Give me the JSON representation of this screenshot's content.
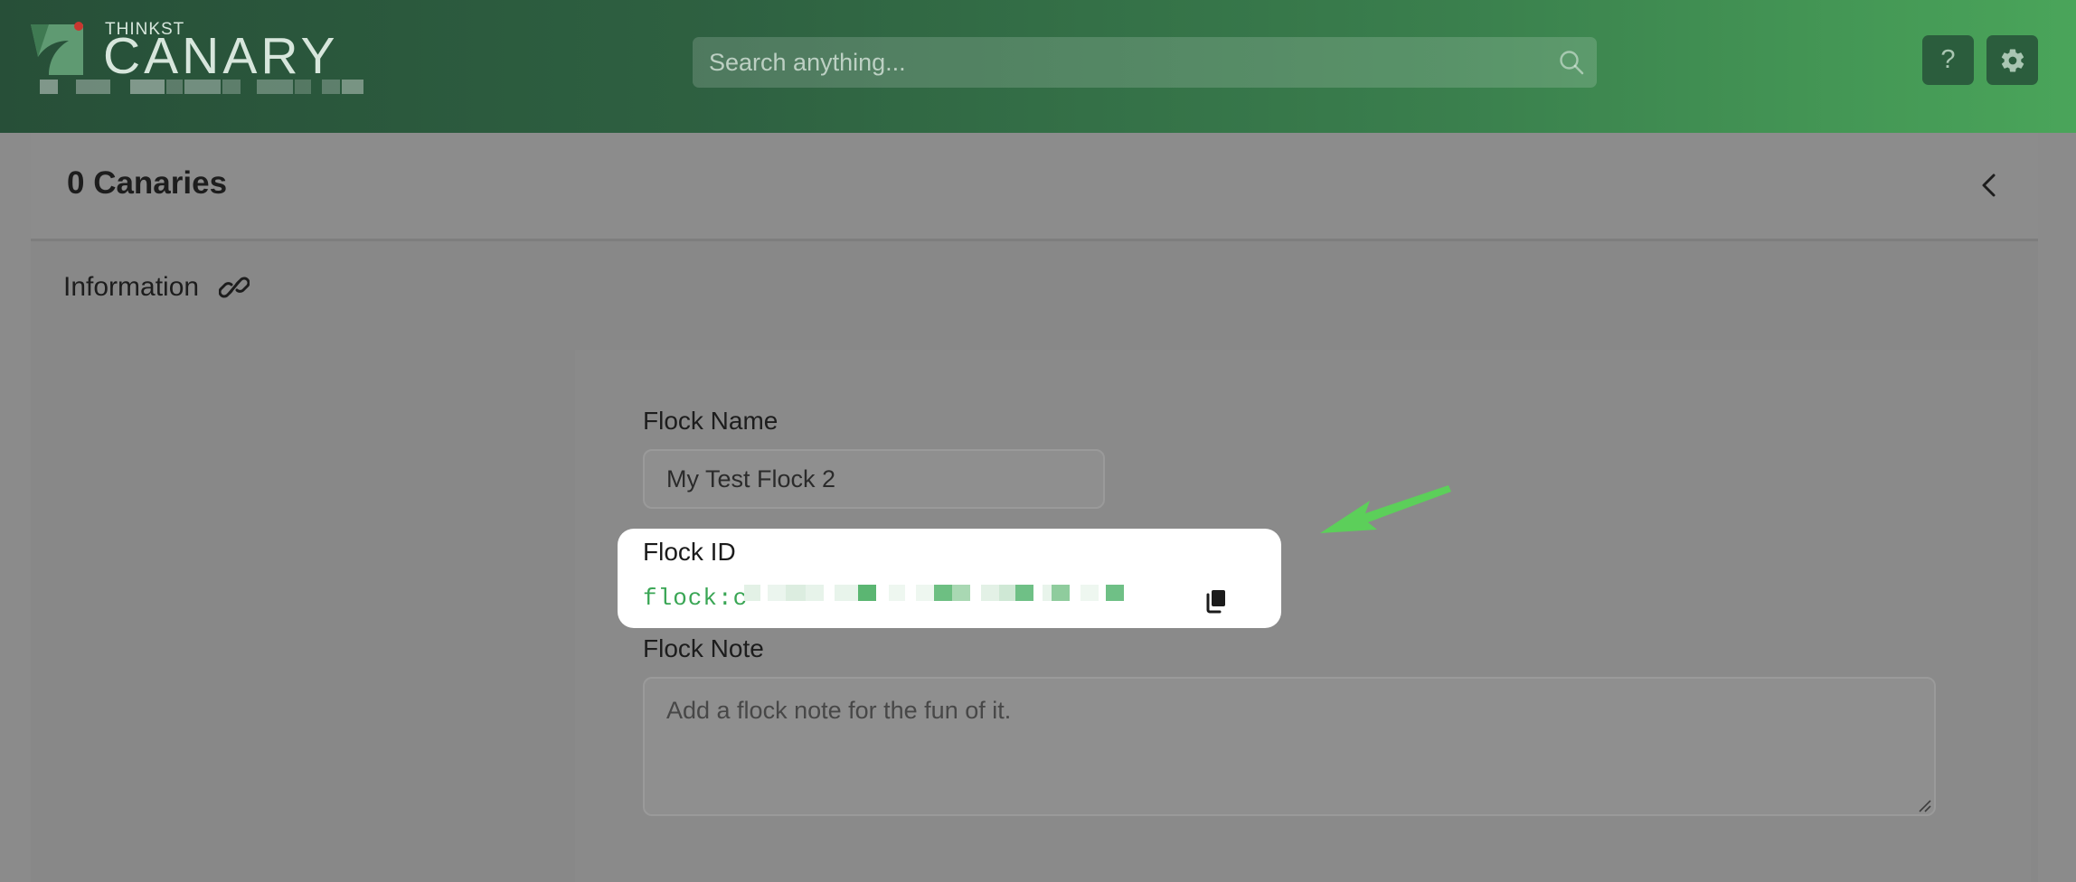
{
  "header": {
    "brand_small": "THINKST",
    "brand_name": "CANARY",
    "search_placeholder": "Search anything...",
    "help_label": "?",
    "settings_icon": "gear-icon",
    "search_icon": "search-icon"
  },
  "panel": {
    "title": "0 Canaries",
    "collapse_icon": "chevron-left-icon"
  },
  "section": {
    "title": "Information",
    "link_icon": "link-icon"
  },
  "form": {
    "flock_name_label": "Flock Name",
    "flock_name_value": "My Test Flock 2",
    "flock_id_label": "Flock ID",
    "flock_id_value": "flock:c",
    "copy_icon": "copy-icon",
    "flock_note_label": "Flock Note",
    "flock_note_placeholder": "Add a flock note for the fun of it."
  },
  "colors": {
    "header_start": "#274f38",
    "header_end": "#4aa55a",
    "flock_id_green": "#3aa655",
    "annotation_arrow": "#5ccf5a"
  }
}
